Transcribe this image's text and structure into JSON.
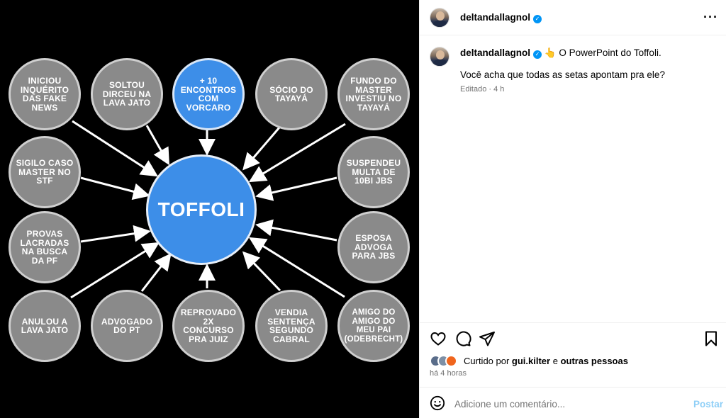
{
  "post": {
    "username": "deltandallagnol",
    "more_icon": "more-horizontal-icon",
    "caption_emoji": "👆",
    "caption_line1": "O PowerPoint do Toffoli.",
    "caption_line2": "Você acha que todas as setas apontam pra ele?",
    "caption_meta": "Editado · 4 h",
    "liked_by_prefix": "Curtido por ",
    "liked_by_user": "gui.kilter",
    "liked_by_join": " e ",
    "liked_by_rest": "outras pessoas",
    "time_ago": "há 4 horas",
    "comment_placeholder": "Adicione um comentário...",
    "post_button": "Postar",
    "icons": [
      "heart-icon",
      "comment-icon",
      "share-icon",
      "bookmark-icon",
      "emoji-icon"
    ],
    "accent_color": "#0095f6"
  },
  "diagram": {
    "center": "TOFFOLI",
    "nodes": [
      "INICIOU INQUÉRITO DAS FAKE NEWS",
      "SOLTOU DIRCEU NA LAVA JATO",
      "+ 10 ENCONTROS COM VORCARO",
      "SÓCIO DO TAYAYÁ",
      "FUNDO DO MASTER INVESTIU NO TAYAYÁ",
      "SIGILO CASO MASTER NO STF",
      "SUSPENDEU MULTA DE 10BI JBS",
      "PROVAS LACRADAS NA BUSCA DA PF",
      "ESPOSA ADVOGA PARA JBS",
      "ANULOU A LAVA JATO",
      "ADVOGADO DO PT",
      "REPROVADO 2X CONCURSO PRA JUIZ",
      "VENDIA SENTENÇA SEGUNDO CABRAL",
      "AMIGO DO AMIGO DO MEU PAI (ODEBRECHT)"
    ],
    "node_color": "#8a8a8a",
    "highlight_color": "#3d8ee8"
  }
}
